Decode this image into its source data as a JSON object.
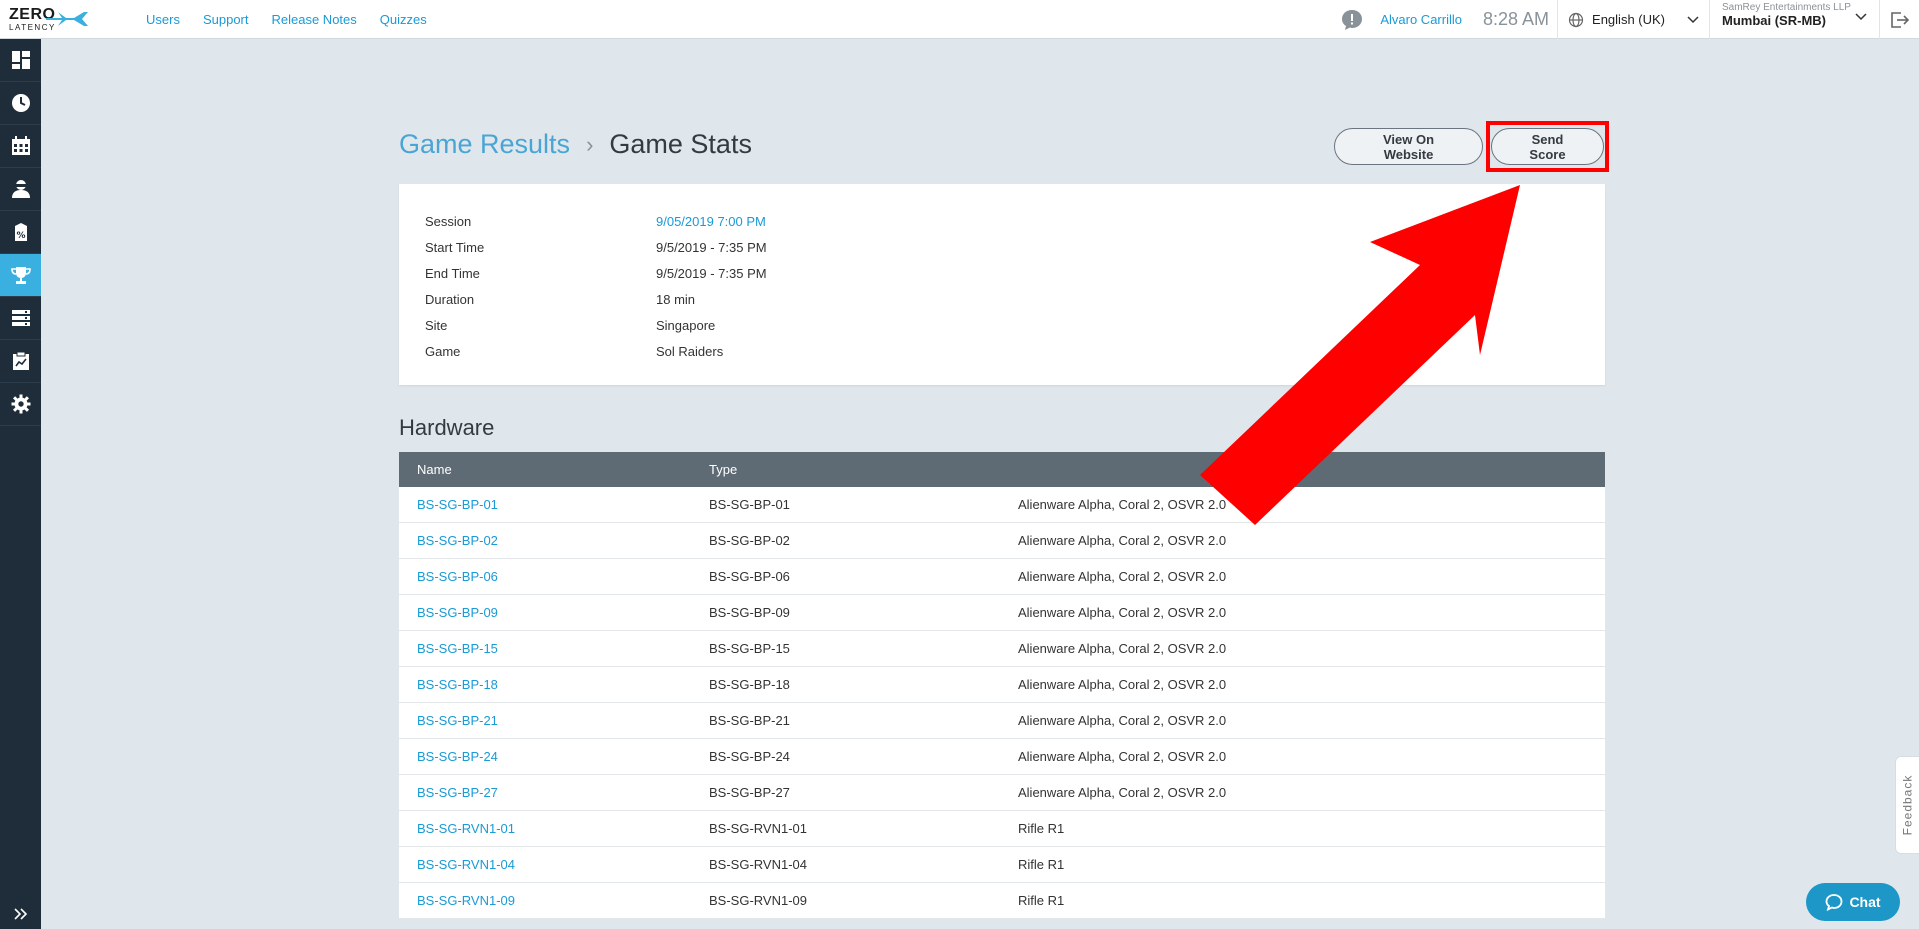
{
  "header": {
    "logo_line1": "ZERO",
    "logo_line2": "LATENCY",
    "nav": [
      "Users",
      "Support",
      "Release Notes",
      "Quizzes"
    ],
    "user_name": "Alvaro Carrillo",
    "time": "8:28 AM",
    "language": "English (UK)",
    "company": "SamRey Entertainments LLP",
    "site": "Mumbai (SR-MB)"
  },
  "breadcrumb": {
    "parent": "Game Results",
    "separator": "›",
    "current": "Game Stats"
  },
  "actions": {
    "view_label": "View On Website",
    "send_label": "Send Score"
  },
  "session": [
    {
      "key": "Session",
      "value": "9/05/2019 7:00 PM"
    },
    {
      "key": "Start Time",
      "value": "9/5/2019 - 7:35 PM"
    },
    {
      "key": "End Time",
      "value": "9/5/2019 - 7:35 PM"
    },
    {
      "key": "Duration",
      "value": "18 min"
    },
    {
      "key": "Site",
      "value": "Singapore"
    },
    {
      "key": "Game",
      "value": "Sol Raiders"
    }
  ],
  "hardware": {
    "title": "Hardware",
    "columns": [
      "Name",
      "Type",
      ""
    ],
    "rows": [
      [
        "BS-SG-BP-01",
        "BS-SG-BP-01",
        "Alienware Alpha, Coral 2, OSVR 2.0"
      ],
      [
        "BS-SG-BP-02",
        "BS-SG-BP-02",
        "Alienware Alpha, Coral 2, OSVR 2.0"
      ],
      [
        "BS-SG-BP-06",
        "BS-SG-BP-06",
        "Alienware Alpha, Coral 2, OSVR 2.0"
      ],
      [
        "BS-SG-BP-09",
        "BS-SG-BP-09",
        "Alienware Alpha, Coral 2, OSVR 2.0"
      ],
      [
        "BS-SG-BP-15",
        "BS-SG-BP-15",
        "Alienware Alpha, Coral 2, OSVR 2.0"
      ],
      [
        "BS-SG-BP-18",
        "BS-SG-BP-18",
        "Alienware Alpha, Coral 2, OSVR 2.0"
      ],
      [
        "BS-SG-BP-21",
        "BS-SG-BP-21",
        "Alienware Alpha, Coral 2, OSVR 2.0"
      ],
      [
        "BS-SG-BP-24",
        "BS-SG-BP-24",
        "Alienware Alpha, Coral 2, OSVR 2.0"
      ],
      [
        "BS-SG-BP-27",
        "BS-SG-BP-27",
        "Alienware Alpha, Coral 2, OSVR 2.0"
      ],
      [
        "BS-SG-RVN1-01",
        "BS-SG-RVN1-01",
        "Rifle R1"
      ],
      [
        "BS-SG-RVN1-04",
        "BS-SG-RVN1-04",
        "Rifle R1"
      ],
      [
        "BS-SG-RVN1-09",
        "BS-SG-RVN1-09",
        "Rifle R1"
      ]
    ]
  },
  "sidebar_icons": [
    "dashboard-icon",
    "clock-icon",
    "calendar-icon",
    "player-icon",
    "discount-icon",
    "trophy-icon",
    "server-icon",
    "report-icon",
    "gear-icon"
  ],
  "feedback_label": "Feedback",
  "chat_label": "Chat",
  "colors": {
    "accent": "#1a9ad6",
    "sidebar": "#1f2d3a",
    "active": "#39b0e0",
    "annotation": "#ff0000"
  }
}
